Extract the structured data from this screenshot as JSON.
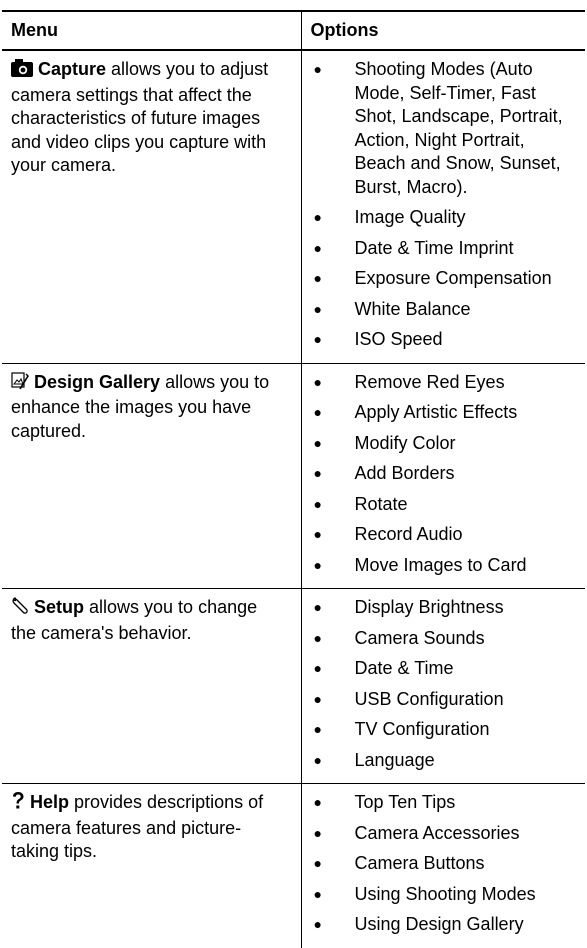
{
  "headers": {
    "menu": "Menu",
    "options": "Options"
  },
  "rows": [
    {
      "icon": "camera-icon",
      "title": "Capture",
      "text": " allows you to adjust camera settings that affect the characteristics of future images and video clips you capture with your camera.",
      "options": [
        "Shooting Modes (Auto Mode, Self-Timer, Fast Shot, Landscape, Portrait, Action, Night Portrait, Beach and Snow, Sunset, Burst, Macro).",
        "Image Quality",
        "Date & Time Imprint",
        "Exposure Compensation",
        "White Balance",
        "ISO Speed"
      ]
    },
    {
      "icon": "design-gallery-icon",
      "title": "Design Gallery",
      "text": " allows you to enhance the images you have captured.",
      "options": [
        "Remove Red Eyes",
        "Apply Artistic Effects",
        "Modify Color",
        "Add Borders",
        "Rotate",
        "Record Audio",
        "Move Images to Card"
      ]
    },
    {
      "icon": "wrench-icon",
      "title": "Setup",
      "text": " allows you to change the camera's behavior.",
      "options": [
        "Display Brightness",
        "Camera Sounds",
        "Date & Time",
        "USB Configuration",
        "TV Configuration",
        "Language"
      ]
    },
    {
      "icon": "help-icon",
      "title": "Help",
      "text": " provides descriptions of camera features and picture-taking tips.",
      "options": [
        "Top Ten Tips",
        "Camera Accessories",
        "Camera Buttons",
        "Using Shooting Modes",
        "Using Design Gallery"
      ]
    }
  ]
}
